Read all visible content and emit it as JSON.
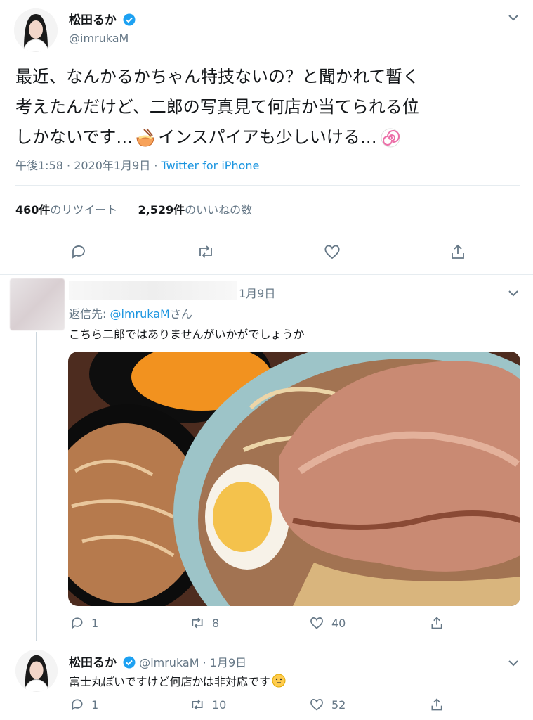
{
  "main_tweet": {
    "display_name": "松田るか",
    "handle": "@imrukaM",
    "text_line1": "最近、なんかるかちゃん特技ないの？と聞かれて暫く",
    "text_line2": "考えたんだけど、二郎の写真見て何店か当てられる位",
    "text_line3_a": "しかないです…",
    "text_line3_b": "インスパイアも少しいける…",
    "time": "午後1:58 · 2020年1月9日 ·",
    "client": "Twitter for iPhone",
    "retweets_count": "460件",
    "retweets_label": "のリツイート",
    "likes_count": "2,529件",
    "likes_label": "のいいねの数"
  },
  "reply1": {
    "date": "1月9日",
    "reply_to_label": "返信先:",
    "reply_to_handle": "@imrukaM",
    "reply_to_suffix": "さん",
    "text": "こちら二郎ではありませんがいかがでしょうか",
    "reply_count": "1",
    "retweet_count": "8",
    "like_count": "40"
  },
  "reply2": {
    "display_name": "松田るか",
    "handle": "@imrukaM",
    "date": "· 1月9日",
    "text": "富士丸ぽいですけど何店かは非対応です",
    "reply_count": "1",
    "retweet_count": "10",
    "like_count": "52"
  },
  "colors": {
    "accent": "#1da1f2",
    "muted": "#657786",
    "border": "#e6ecf0"
  }
}
